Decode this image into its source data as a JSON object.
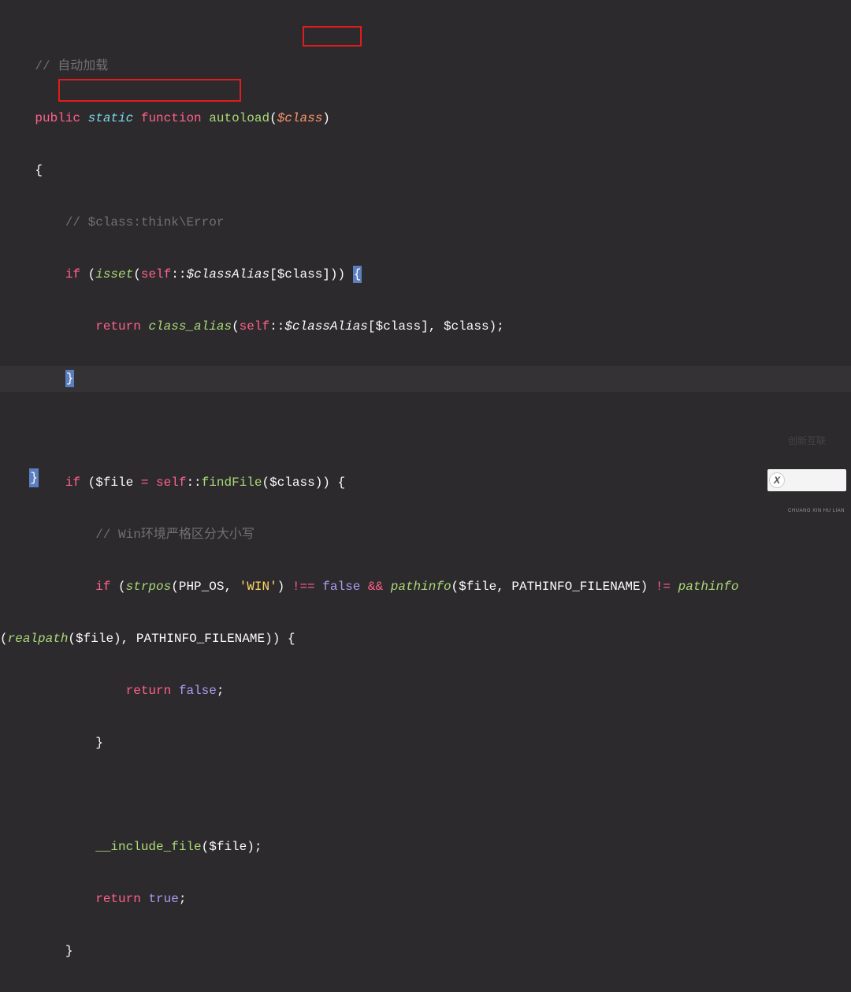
{
  "code": {
    "l1_comment": "// 自动加载",
    "l2_public": "public",
    "l2_static": "static",
    "l2_function": "function",
    "l2_name": "autoload",
    "l2_open": "(",
    "l2_param": "$class",
    "l2_close": ")",
    "l3_brace": "{",
    "l4_comment": "// $class:think\\Error",
    "l5_if": "if",
    "l5_open": " (",
    "l5_isset": "isset",
    "l5_p1": "(",
    "l5_self": "self",
    "l5_scope": "::",
    "l5_classAlias": "$classAlias",
    "l5_b1": "[",
    "l5_class": "$class",
    "l5_b2": "])) ",
    "l5_brace_hl": "{",
    "l6_return": "return",
    "l6_sp": " ",
    "l6_call": "class_alias",
    "l6_p1": "(",
    "l6_self": "self",
    "l6_scope": "::",
    "l6_classAlias": "$classAlias",
    "l6_b1": "[",
    "l6_class1": "$class",
    "l6_b2": "], ",
    "l6_class2": "$class",
    "l6_end": ");",
    "l7_brace_hl": "}",
    "l9_if": "if",
    "l9_open": " (",
    "l9_file": "$file",
    "l9_eq": " = ",
    "l9_self": "self",
    "l9_scope": "::",
    "l9_findFile": "findFile",
    "l9_p1": "(",
    "l9_class": "$class",
    "l9_close": ")) {",
    "l10_comment": "// Win环境严格区分大小写",
    "l11_if": "if",
    "l11_open": " (",
    "l11_strpos": "strpos",
    "l11_p1": "(",
    "l11_phpos": "PHP_OS",
    "l11_comma": ", ",
    "l11_win": "'WIN'",
    "l11_p2": ") ",
    "l11_neq": "!==",
    "l11_sp1": " ",
    "l11_false": "false",
    "l11_sp2": " ",
    "l11_and": "&&",
    "l11_sp3": " ",
    "l11_pathinfo1": "pathinfo",
    "l11_p3": "(",
    "l11_file2": "$file",
    "l11_comma2": ", ",
    "l11_pconst": "PATHINFO_FILENAME",
    "l11_p4": ") ",
    "l11_ne": "!=",
    "l11_sp4": " ",
    "l11_pathinfo2": "pathinfo",
    "l12_pre": "(",
    "l12_realpath": "realpath",
    "l12_p1": "(",
    "l12_file": "$file",
    "l12_p2": "), ",
    "l12_pconst": "PATHINFO_FILENAME",
    "l12_close": ")) {",
    "l13_return": "return",
    "l13_sp": " ",
    "l13_false": "false",
    "l13_semi": ";",
    "l14_brace": "}",
    "l16_include": "__include_file",
    "l16_p1": "(",
    "l16_file": "$file",
    "l16_p2": ");",
    "l17_return": "return",
    "l17_sp": " ",
    "l17_true": "true",
    "l17_semi": ";",
    "l18_brace": "}",
    "l19_brace": "}"
  },
  "red_boxes": [
    "$class",
    "// $class:think\\Error"
  ],
  "watermark": {
    "icon": "X",
    "text": "创新互联",
    "sub": "CHUANG XIN HU LIAN"
  }
}
